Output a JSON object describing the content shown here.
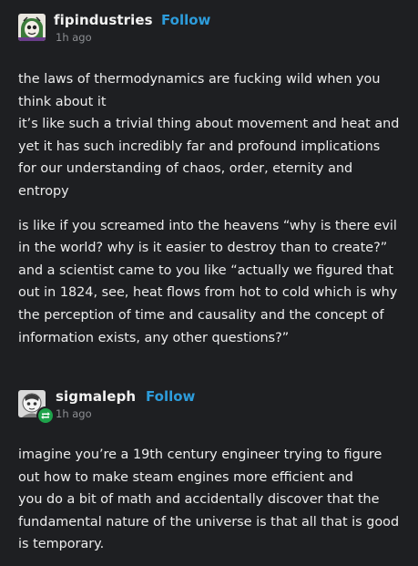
{
  "colors": {
    "background": "#1e1f22",
    "text": "#ededed",
    "follow_link": "#2d9cdb",
    "muted": "#8d8f93",
    "reblog_badge": "#1ea34b"
  },
  "posts": [
    {
      "username": "fipindustries",
      "follow_label": "Follow",
      "timestamp": "1h ago",
      "avatar_icon": "avatar-icon",
      "paragraphs": [
        {
          "lines": [
            "the laws of thermodynamics are fucking wild when you",
            "think about it",
            "it’s like such a trivial thing about movement and heat and",
            "yet it has such incredibly far and profound implications",
            "for our understanding of chaos, order, eternity and",
            "entropy"
          ]
        },
        {
          "lines": [
            "is like if you screamed into the heavens “why is there evil",
            "in the world? why is it easier to destroy than to create?”",
            "and a scientist came to you like “actually we figured that",
            "out in 1824, see, heat flows from hot to cold which is why",
            "the perception of time and causality and the concept of",
            "information exists, any other questions?”"
          ]
        }
      ]
    },
    {
      "username": "sigmaleph",
      "follow_label": "Follow",
      "timestamp": "1h ago",
      "avatar_icon": "avatar-icon",
      "badge_icon": "reblog-icon",
      "paragraphs": [
        {
          "lines": [
            "imagine you’re a 19th century engineer trying to figure",
            "out how to make steam engines more efficient and",
            "you do a bit of math and accidentally discover that the",
            "fundamental nature of the universe is that all that is good",
            "is temporary."
          ]
        }
      ]
    }
  ]
}
